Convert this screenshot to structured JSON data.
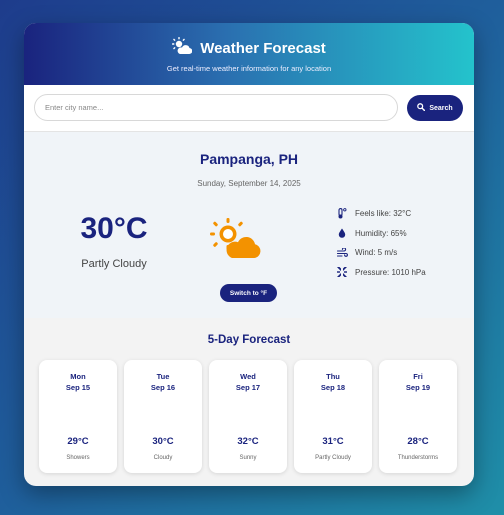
{
  "header": {
    "title": "Weather Forecast",
    "subtitle": "Get real-time weather information for any location",
    "icon": "sun-cloud-icon"
  },
  "search": {
    "placeholder": "Enter city name...",
    "value": "",
    "button_label": "Search",
    "button_icon": "search-icon"
  },
  "current": {
    "city": "Pampanga, PH",
    "date": "Sunday, September 14, 2025",
    "temperature": "30°C",
    "condition": "Partly Cloudy",
    "icon": "partly-cloudy-icon",
    "unit_toggle_label": "Switch to °F",
    "details": [
      {
        "icon": "thermometer-icon",
        "text": "Feels like: 32°C"
      },
      {
        "icon": "droplet-icon",
        "text": "Humidity: 65%"
      },
      {
        "icon": "wind-icon",
        "text": "Wind: 5 m/s"
      },
      {
        "icon": "pressure-icon",
        "text": "Pressure: 1010 hPa"
      }
    ]
  },
  "forecast": {
    "title": "5-Day Forecast",
    "days": [
      {
        "day": "Mon",
        "date": "Sep 15",
        "icon_glyph": "",
        "temp": "29°C",
        "condition": "Showers"
      },
      {
        "day": "Tue",
        "date": "Sep 16",
        "icon_glyph": "",
        "temp": "30°C",
        "condition": "Cloudy"
      },
      {
        "day": "Wed",
        "date": "Sep 17",
        "icon_glyph": "",
        "temp": "32°C",
        "condition": "Sunny"
      },
      {
        "day": "Thu",
        "date": "Sep 18",
        "icon_glyph": "",
        "temp": "31°C",
        "condition": "Partly Cloudy"
      },
      {
        "day": "Fri",
        "date": "Sep 19",
        "icon_glyph": "",
        "temp": "28°C",
        "condition": "Thunderstorms"
      }
    ]
  },
  "colors": {
    "primary": "#1a237e",
    "accent": "#24c3cc",
    "icon_orange": "#f39200"
  }
}
